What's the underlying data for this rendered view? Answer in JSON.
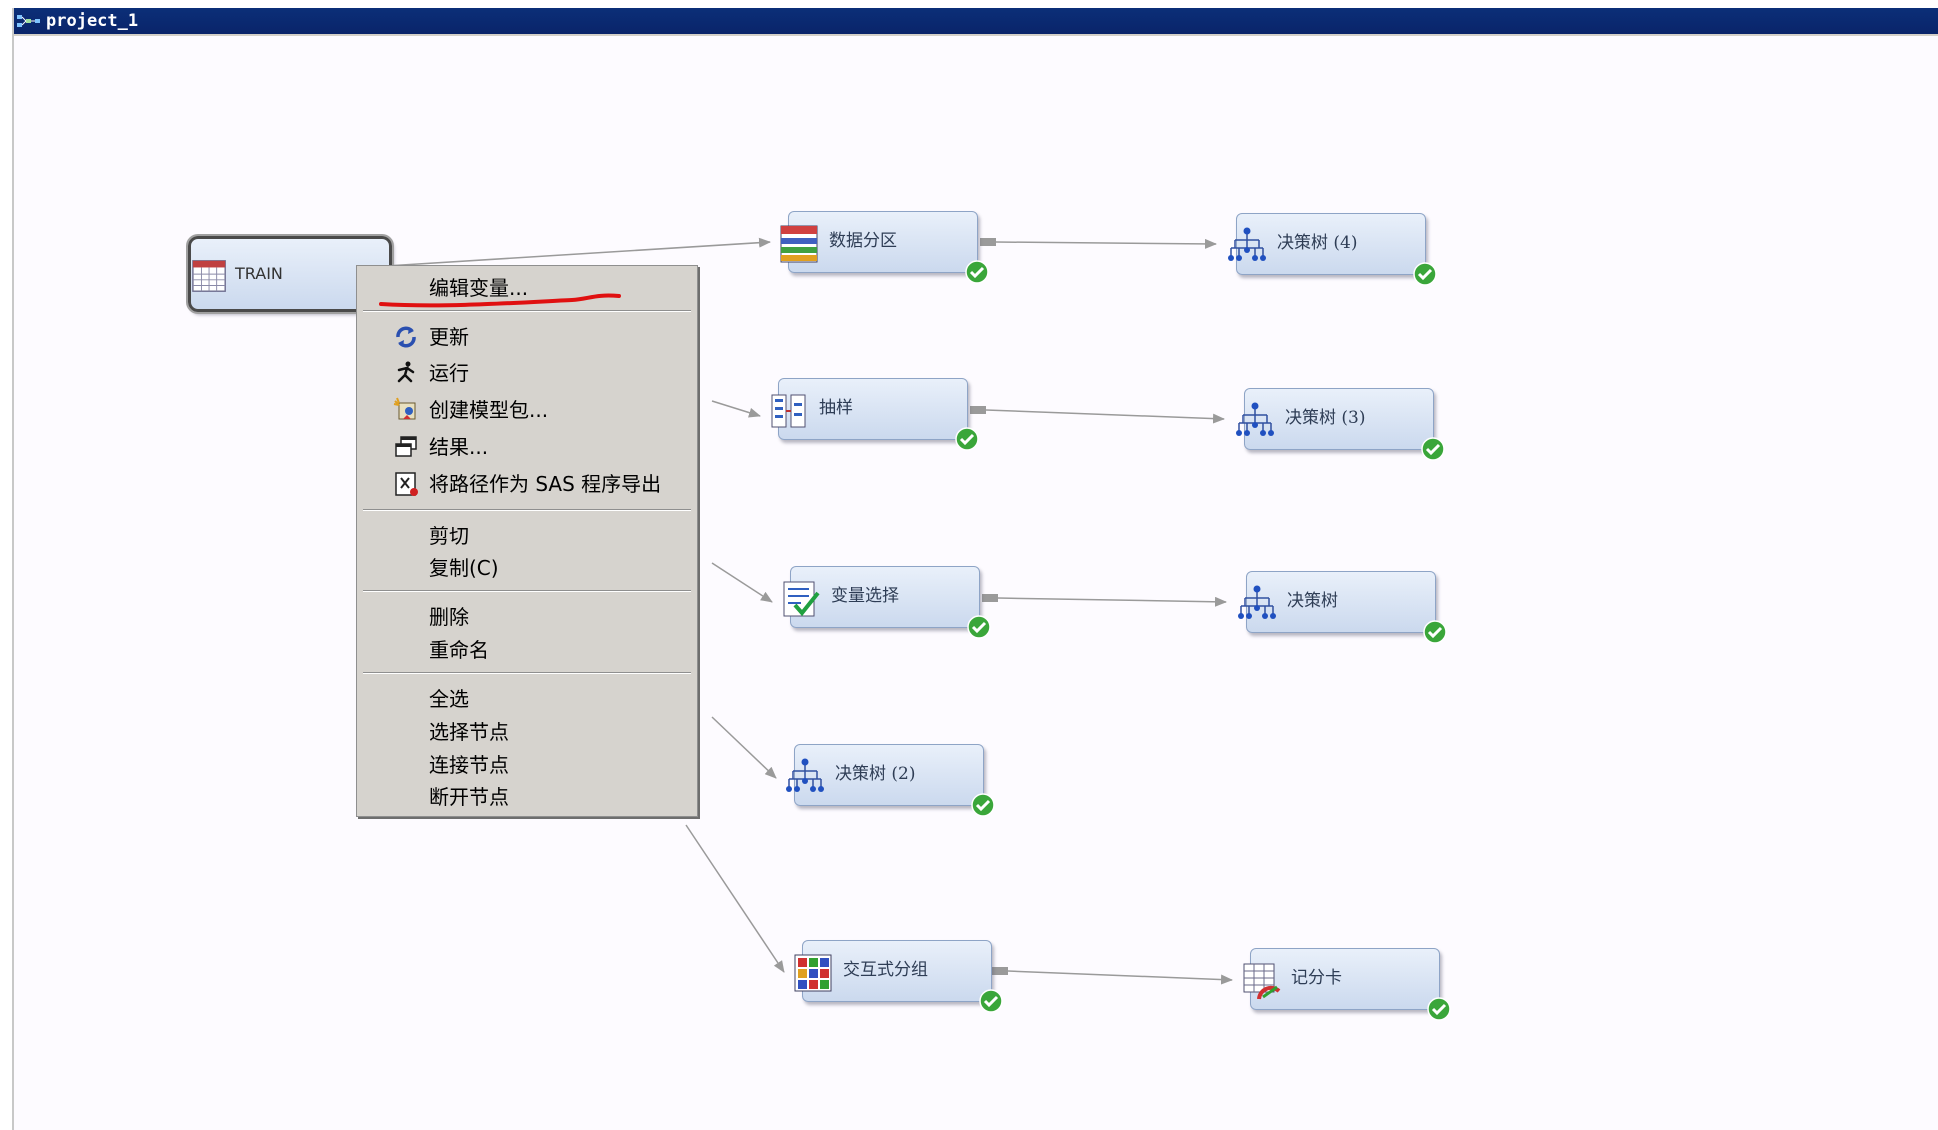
{
  "window": {
    "title": "project_1"
  },
  "nodes": {
    "train": {
      "label": "TRAIN",
      "icon": "data-table-icon"
    },
    "partition": {
      "label": "数据分区",
      "icon": "data-partition-icon",
      "status": "success"
    },
    "tree4": {
      "label": "决策树 (4)",
      "icon": "decision-tree-icon",
      "status": "success"
    },
    "sample": {
      "label": "抽样",
      "icon": "sample-icon",
      "status": "success"
    },
    "tree3": {
      "label": "决策树 (3)",
      "icon": "decision-tree-icon",
      "status": "success"
    },
    "varselect": {
      "label": "变量选择",
      "icon": "variable-selection-icon",
      "status": "success"
    },
    "tree": {
      "label": "决策树",
      "icon": "decision-tree-icon",
      "status": "success"
    },
    "tree2": {
      "label": "决策树 (2)",
      "icon": "decision-tree-icon",
      "status": "success"
    },
    "igroup": {
      "label": "交互式分组",
      "icon": "interactive-grouping-icon",
      "status": "success"
    },
    "scorecard": {
      "label": "记分卡",
      "icon": "scorecard-icon",
      "status": "success"
    }
  },
  "context_menu": {
    "edit_variables": "编辑变量...",
    "update": "更新",
    "run": "运行",
    "create_model_package": "创建模型包...",
    "results": "结果...",
    "export_path_sas": "将路径作为 SAS 程序导出",
    "cut": "剪切",
    "copy": "复制(C)",
    "delete": "删除",
    "rename": "重命名",
    "select_all": "全选",
    "select_nodes": "选择节点",
    "connect_nodes": "连接节点",
    "disconnect_nodes": "断开节点"
  },
  "colors": {
    "titlebar": "#0a246a",
    "node_fill": "#cbd9ee",
    "success": "#3aa63a",
    "annotation": "#e01010",
    "menu_bg": "#d6d3ce"
  }
}
